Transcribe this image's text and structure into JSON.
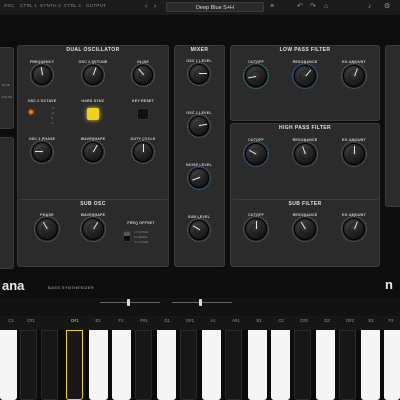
{
  "topbar": {
    "tabs": [
      "OSC",
      "CTRL 1",
      "SYNTH 2",
      "CTRL 2",
      "OUTPUT"
    ],
    "preset_name": "Deep Blue S+H",
    "prev_symbol": "‹",
    "next_symbol": "›",
    "undo_symbol": "↶",
    "redo_symbol": "↷",
    "list_symbol": "≡",
    "save_symbol": "⌂",
    "bell_symbol": "♪",
    "gear_symbol": "⚙"
  },
  "panels": {
    "dual_osc": {
      "title": "DUAL OSCILLATOR",
      "frequency": "FREQUENCY",
      "osc2_detune": "OSC 2 DETUNE",
      "glide": "GLIDE",
      "osc2_octave": "OSC 2 OCTAVE",
      "hard_sync": "HARD SYNC",
      "key_reset": "KEY RESET",
      "osc2_phase": "OSC 2 PHASE",
      "waveshape": "WAVESHAPE",
      "duty_cycle": "DUTY CYCLE",
      "octave_opts": [
        "+2",
        "+1",
        "0",
        "-1"
      ]
    },
    "mixer": {
      "title": "MIXER",
      "osc1_level": "OSC 1 LEVEL",
      "osc2_level": "OSC 2 LEVEL",
      "noise_level": "NOISE LEVEL",
      "sub_level": "SUB LEVEL"
    },
    "lpf": {
      "title": "LOW PASS FILTER",
      "cutoff": "CUTOFF",
      "resonance": "RESONANCE",
      "eg_amount": "EG AMOUNT"
    },
    "hpf": {
      "title": "HIGH PASS FILTER",
      "cutoff": "CUTOFF",
      "resonance": "RESONANCE",
      "eg_amount": "EG AMOUNT"
    },
    "sub_osc": {
      "title": "SUB OSC",
      "phase": "PHASE",
      "waveshape": "WAVESHAPE",
      "freq_offset": "FREQ OFFSET",
      "offset_opts": [
        "1 OCTAVE",
        "2 LINKED",
        "3 OCTAVE"
      ]
    },
    "sub_filter": {
      "title": "SUB FILTER",
      "cutoff": "CUTOFF",
      "resonance": "RESONANCE",
      "eg_amount": "EG AMOUNT"
    }
  },
  "brand": {
    "logo_left": "ana",
    "subtitle": "BASS SYNTHESIZER",
    "logo_right": "n"
  },
  "keyboard": {
    "note_labels": [
      "C1",
      "C#1",
      "D#1",
      "E1",
      "F1",
      "F#1",
      "G1",
      "G#1",
      "A1",
      "A#1",
      "B1",
      "C2",
      "C#2",
      "D2",
      "D#2",
      "E2",
      "F2"
    ],
    "active_note": "D#1",
    "accent": "#f2d11a"
  },
  "colors": {
    "accent_yellow": "#f2d11a",
    "led_orange": "#ff7a00",
    "panel": "#2b2b2b"
  }
}
